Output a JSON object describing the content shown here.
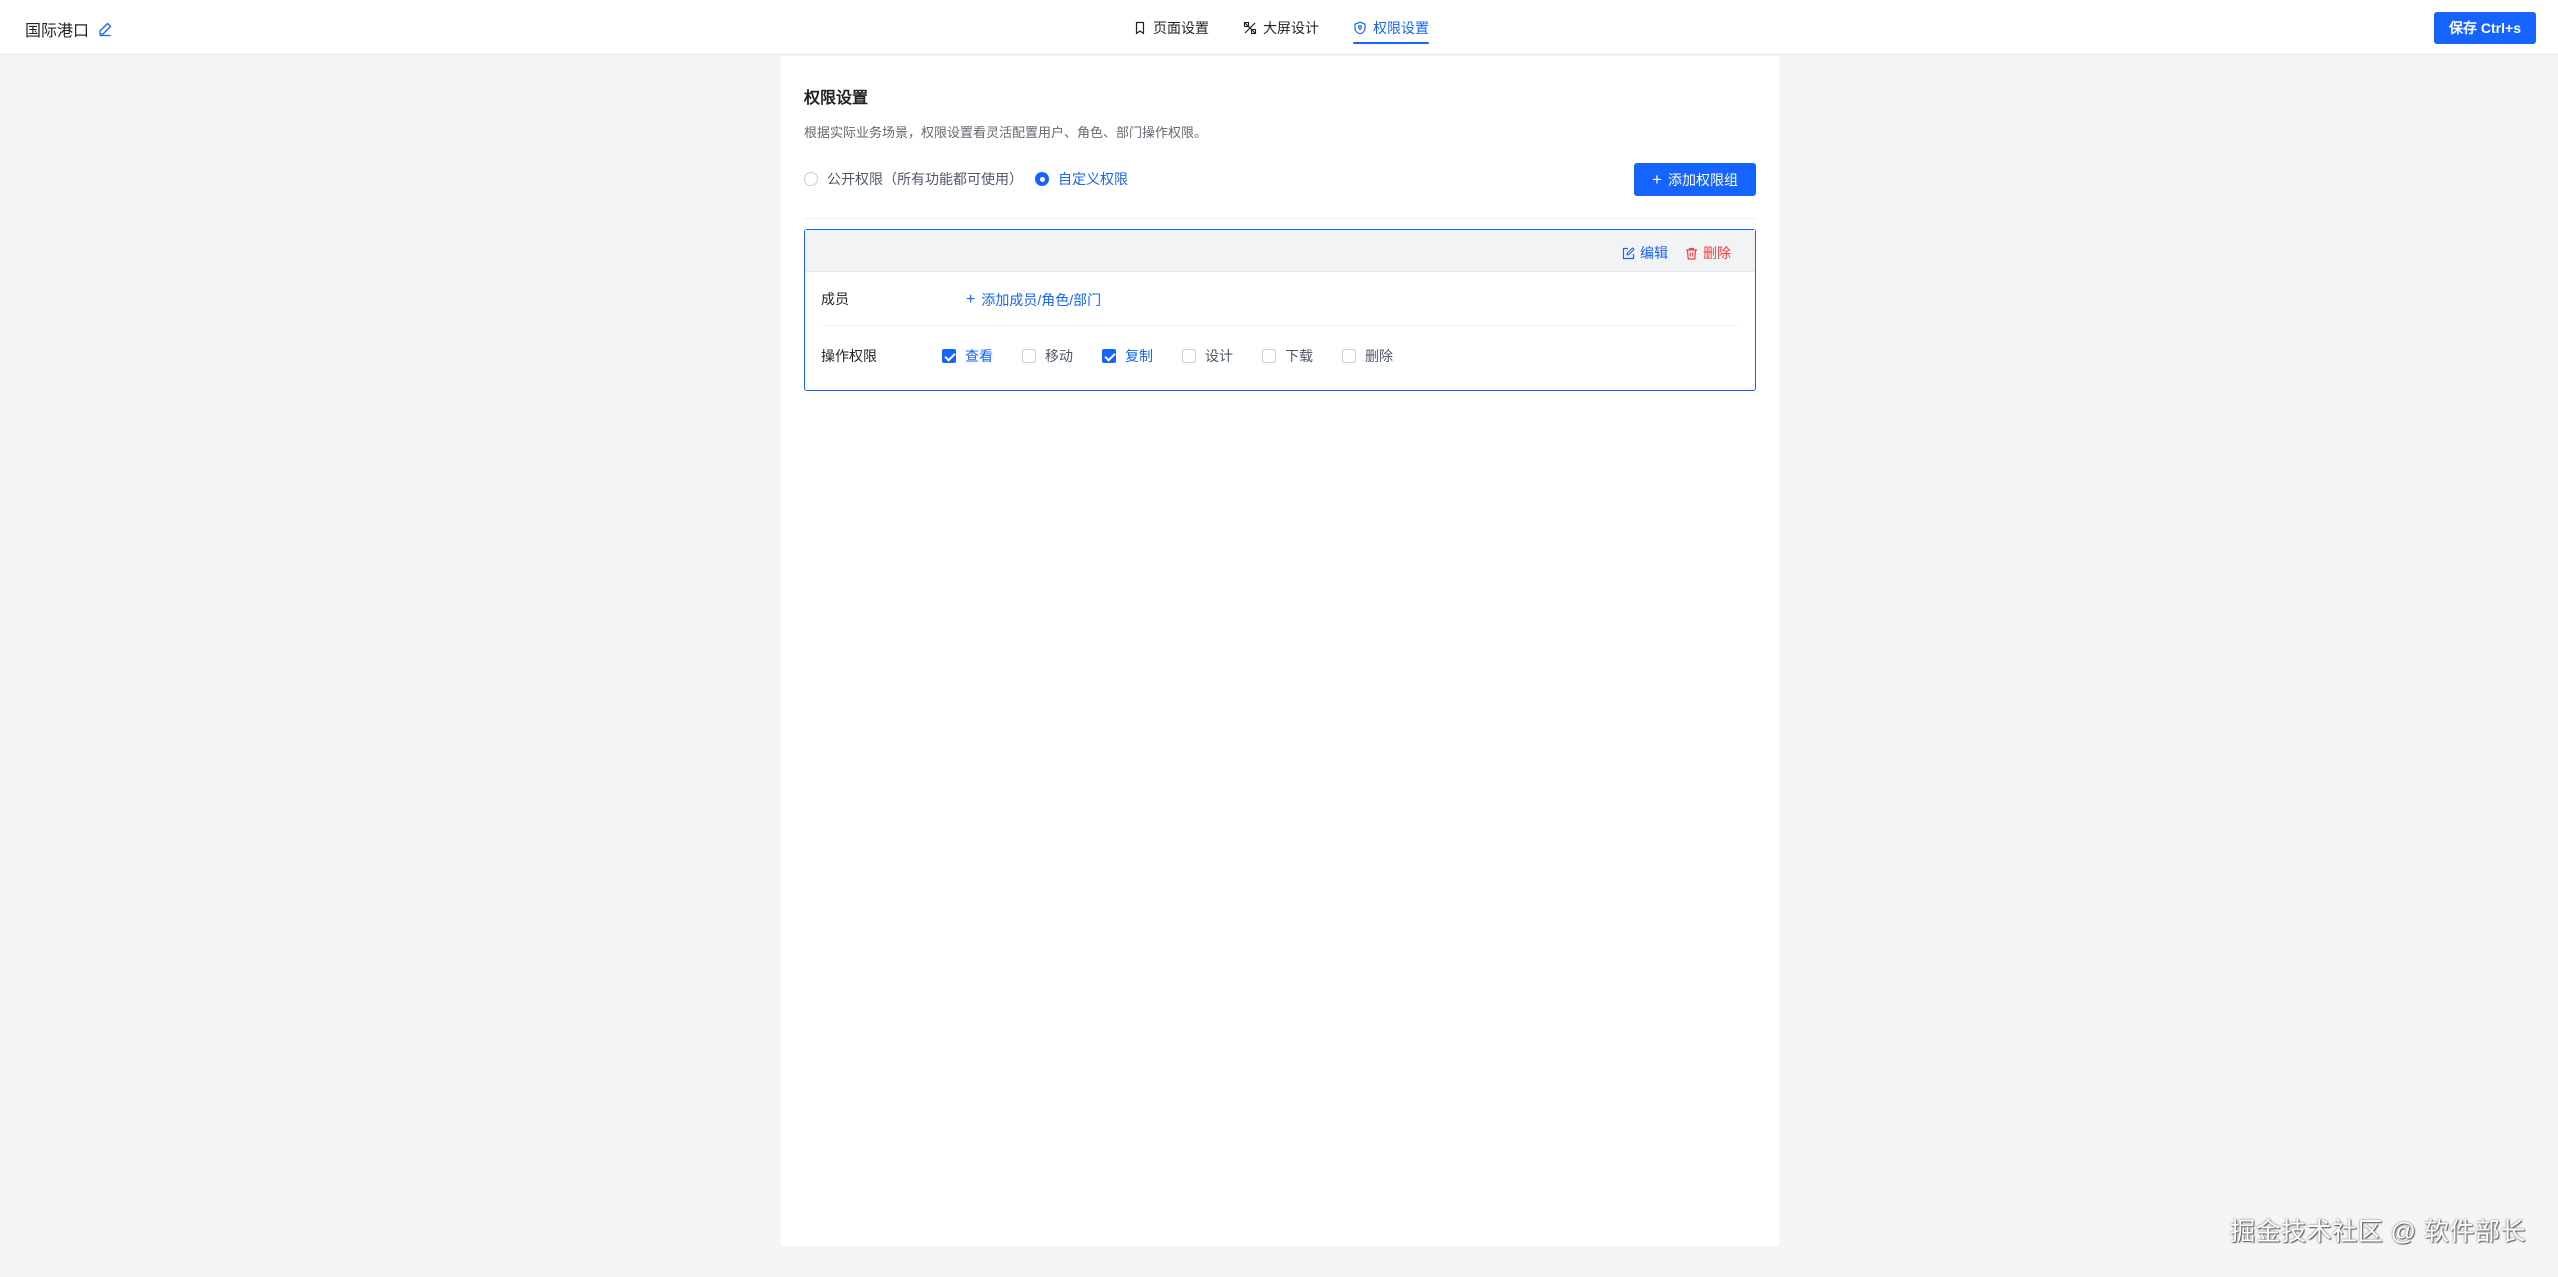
{
  "header": {
    "title": "国际港口",
    "tabs": [
      {
        "label": "页面设置",
        "icon": "bookmark-icon",
        "active": false
      },
      {
        "label": "大屏设计",
        "icon": "design-icon",
        "active": false
      },
      {
        "label": "权限设置",
        "icon": "shield-icon",
        "active": true
      }
    ],
    "save_label": "保存 Ctrl+s"
  },
  "permission": {
    "title": "权限设置",
    "description": "根据实际业务场景，权限设置看灵活配置用户、角色、部门操作权限。",
    "modes": [
      {
        "label": "公开权限（所有功能都可使用）",
        "selected": false
      },
      {
        "label": "自定义权限",
        "selected": true
      }
    ],
    "add_group_label": "添加权限组",
    "group": {
      "edit_label": "编辑",
      "delete_label": "删除",
      "member_label": "成员",
      "add_member_label": "添加成员/角色/部门",
      "operation_label": "操作权限",
      "operations": [
        {
          "label": "查看",
          "checked": true
        },
        {
          "label": "移动",
          "checked": false
        },
        {
          "label": "复制",
          "checked": true
        },
        {
          "label": "设计",
          "checked": false
        },
        {
          "label": "下载",
          "checked": false
        },
        {
          "label": "删除",
          "checked": false
        }
      ]
    }
  },
  "colors": {
    "primary": "#1664ff",
    "danger": "#f53f3f",
    "background": "#f4f5f7"
  },
  "watermark": "掘金技术社区 @ 软件部长"
}
